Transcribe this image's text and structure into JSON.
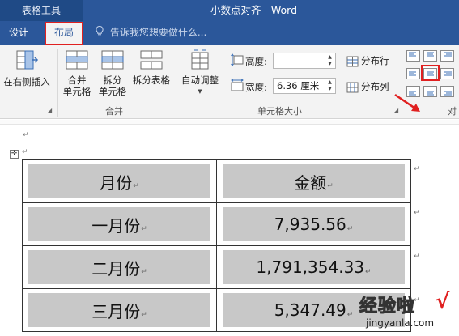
{
  "titlebar": {
    "context_group": "表格工具",
    "document_title": "小数点对齐 - Word"
  },
  "tabs": {
    "design": "设计",
    "layout": "布局",
    "tell_me": "告诉我您想要做什么..."
  },
  "ribbon": {
    "rows_columns": {
      "insert_right": "在右侧插入"
    },
    "merge": {
      "merge_cells_line1": "合并",
      "merge_cells_line2": "单元格",
      "split_cells_line1": "拆分",
      "split_cells_line2": "单元格",
      "split_table": "拆分表格",
      "group_label": "合并"
    },
    "cell_size": {
      "autofit": "自动调整",
      "height_label": "高度:",
      "height_value": "",
      "width_label": "宽度:",
      "width_value": "6.36 厘米",
      "distribute_rows": "分布行",
      "distribute_columns": "分布列",
      "group_label": "单元格大小"
    },
    "alignment": {
      "group_label": "对"
    }
  },
  "table": {
    "rows": [
      [
        "月份",
        "金额"
      ],
      [
        "一月份",
        "7,935.56"
      ],
      [
        "二月份",
        "1,791,354.33"
      ],
      [
        "三月份",
        "5,347.49"
      ]
    ]
  },
  "watermark": {
    "main": "经验啦",
    "check": "√",
    "url": "jingyanla.com"
  },
  "colors": {
    "word_blue": "#2b579a",
    "highlight_red": "#e02020",
    "cell_shading": "#c8c8c8"
  }
}
